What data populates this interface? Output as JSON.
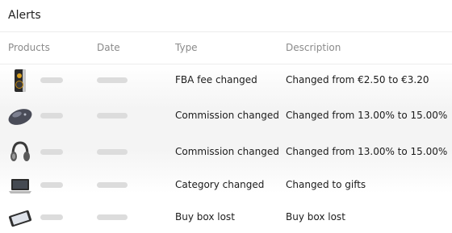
{
  "header": {
    "title": "Alerts"
  },
  "columns": {
    "products": "Products",
    "date": "Date",
    "type": "Type",
    "description": "Description"
  },
  "rows": [
    {
      "product_icon": "speaker-icon",
      "type": "FBA fee changed",
      "description": "Changed from €2.50 to €3.20"
    },
    {
      "product_icon": "mouse-icon",
      "type": "Commission changed",
      "description": "Changed from 13.00% to 15.00%"
    },
    {
      "product_icon": "headphones-icon",
      "type": "Commission changed",
      "description": "Changed from 13.00% to 15.00%"
    },
    {
      "product_icon": "laptop-icon",
      "type": "Category changed",
      "description": "Changed to gifts"
    },
    {
      "product_icon": "tablet-icon",
      "type": "Buy box lost",
      "description": "Buy box lost"
    }
  ]
}
